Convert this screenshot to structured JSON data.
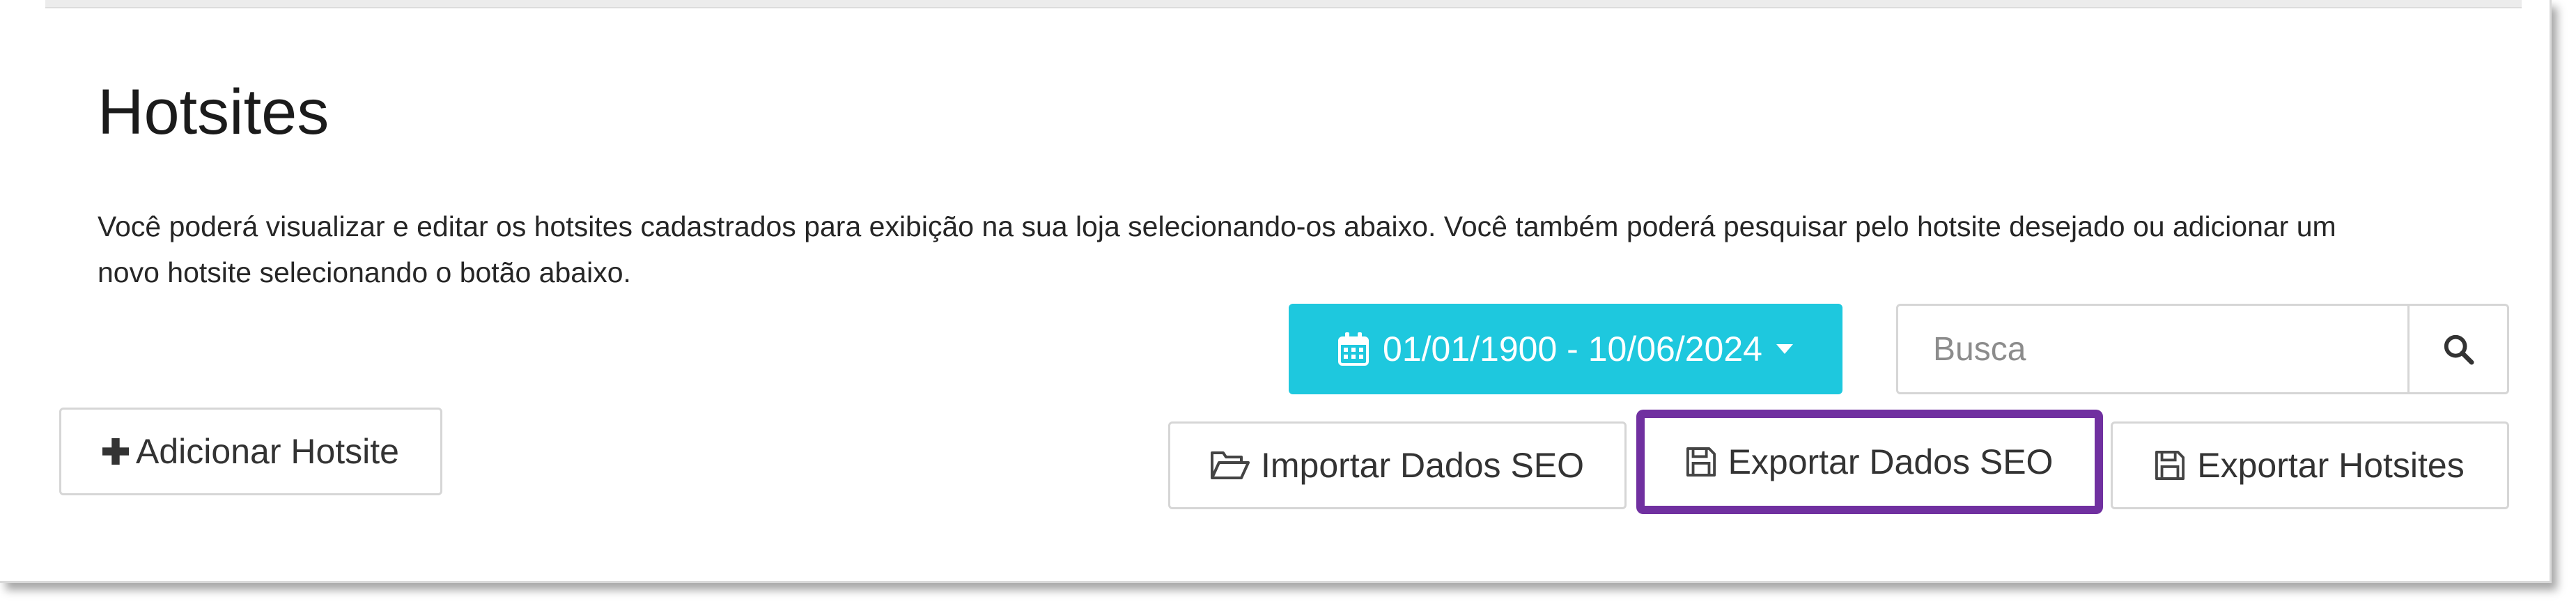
{
  "header": {
    "title": "Hotsites",
    "description": "Você poderá visualizar e editar os hotsites cadastrados para exibição na sua loja selecionando-os abaixo. Você também poderá pesquisar pelo hotsite desejado ou adicionar um novo hotsite selecionando o botão abaixo."
  },
  "filters": {
    "date_range": "01/01/1900 - 10/06/2024",
    "search_placeholder": "Busca"
  },
  "actions": {
    "add_label": "Adicionar Hotsite",
    "import_seo_label": "Importar Dados SEO",
    "export_seo_label": "Exportar Dados SEO",
    "export_hotsites_label": "Exportar Hotsites"
  },
  "icons": {
    "calendar": "calendar-icon",
    "caret": "caret-down-icon",
    "search": "search-icon",
    "plus": "plus-icon",
    "folder": "folder-open-icon",
    "save": "floppy-disk-icon"
  },
  "colors": {
    "primary": "#1ec8de",
    "highlight": "#7030a0"
  }
}
